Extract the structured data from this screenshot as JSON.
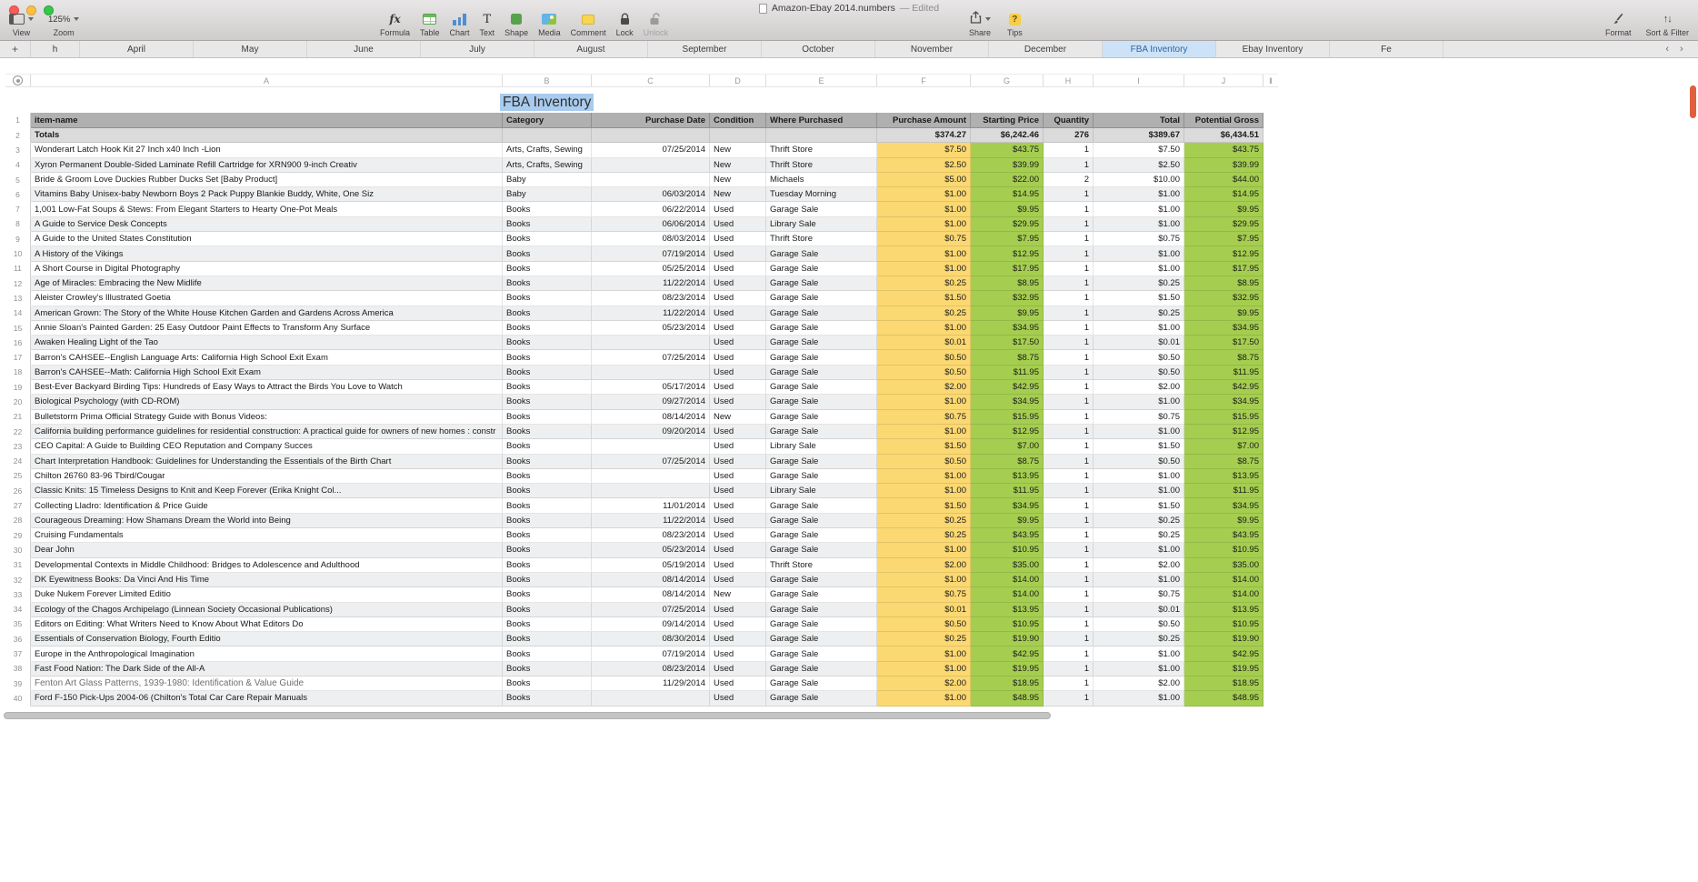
{
  "window": {
    "title": "Amazon-Ebay 2014.numbers",
    "edited": "— Edited"
  },
  "icons": {
    "formula": "fx",
    "text": "T",
    "tips": "?",
    "sort_filter": "↑↓",
    "add_tab": "+",
    "add_column": "‖",
    "tab_prev": "‹",
    "tab_next": "›"
  },
  "toolbar": {
    "view_label": "View",
    "zoom_label": "Zoom",
    "zoom_value": "125%",
    "center": [
      "Formula",
      "Table",
      "Chart",
      "Text",
      "Shape",
      "Media",
      "Comment",
      "Lock",
      "Unlock"
    ],
    "share_label": "Share",
    "tips_label": "Tips",
    "format_label": "Format",
    "sort_filter_label": "Sort & Filter"
  },
  "tabs": {
    "items": [
      "h",
      "April",
      "May",
      "June",
      "July",
      "August",
      "September",
      "October",
      "November",
      "December",
      "FBA Inventory",
      "Ebay Inventory",
      "Fe"
    ],
    "active": "FBA Inventory"
  },
  "sheet": {
    "column_letters": [
      "A",
      "B",
      "C",
      "D",
      "E",
      "F",
      "G",
      "H",
      "I",
      "J"
    ],
    "table_title": "FBA Inventory",
    "first_data_row_number": 3,
    "muted_row_numbers": [
      39
    ],
    "headers": [
      "item-name",
      "Category",
      "Purchase Date",
      "Condition",
      "Where Purchased",
      "Purchase Amount",
      "Starting Price",
      "Quantity",
      "Total",
      "Potential Gross"
    ],
    "totals": [
      "Totals",
      "",
      "",
      "",
      "",
      "$374.27",
      "$6,242.46",
      "276",
      "$389.67",
      "$6,434.51"
    ],
    "rows": [
      [
        "Wonderart Latch Hook Kit 27 Inch x40 Inch -Lion",
        "Arts, Crafts, Sewing",
        "07/25/2014",
        "New",
        "Thrift Store",
        "$7.50",
        "$43.75",
        "1",
        "$7.50",
        "$43.75"
      ],
      [
        "Xyron Permanent Double-Sided Laminate Refill Cartridge for XRN900 9-inch Creativ",
        "Arts, Crafts, Sewing",
        "",
        "New",
        "Thrift Store",
        "$2.50",
        "$39.99",
        "1",
        "$2.50",
        "$39.99"
      ],
      [
        "Bride & Groom Love Duckies Rubber Ducks Set [Baby Product]",
        "Baby",
        "",
        "New",
        "Michaels",
        "$5.00",
        "$22.00",
        "2",
        "$10.00",
        "$44.00"
      ],
      [
        "Vitamins Baby Unisex-baby Newborn Boys 2 Pack Puppy Blankie Buddy, White, One Siz",
        "Baby",
        "06/03/2014",
        "New",
        "Tuesday Morning",
        "$1.00",
        "$14.95",
        "1",
        "$1.00",
        "$14.95"
      ],
      [
        "1,001 Low-Fat Soups & Stews: From Elegant Starters to Hearty One-Pot Meals",
        "Books",
        "06/22/2014",
        "Used",
        "Garage Sale",
        "$1.00",
        "$9.95",
        "1",
        "$1.00",
        "$9.95"
      ],
      [
        "A Guide to Service Desk Concepts",
        "Books",
        "06/06/2014",
        "Used",
        "Library Sale",
        "$1.00",
        "$29.95",
        "1",
        "$1.00",
        "$29.95"
      ],
      [
        "A Guide to the United States Constitution",
        "Books",
        "08/03/2014",
        "Used",
        "Thrift Store",
        "$0.75",
        "$7.95",
        "1",
        "$0.75",
        "$7.95"
      ],
      [
        "A History of the Vikings",
        "Books",
        "07/19/2014",
        "Used",
        "Garage Sale",
        "$1.00",
        "$12.95",
        "1",
        "$1.00",
        "$12.95"
      ],
      [
        "A Short Course in Digital Photography",
        "Books",
        "05/25/2014",
        "Used",
        "Garage Sale",
        "$1.00",
        "$17.95",
        "1",
        "$1.00",
        "$17.95"
      ],
      [
        "Age of Miracles: Embracing the New Midlife",
        "Books",
        "11/22/2014",
        "Used",
        "Garage Sale",
        "$0.25",
        "$8.95",
        "1",
        "$0.25",
        "$8.95"
      ],
      [
        "Aleister Crowley's Illustrated Goetia",
        "Books",
        "08/23/2014",
        "Used",
        "Garage Sale",
        "$1.50",
        "$32.95",
        "1",
        "$1.50",
        "$32.95"
      ],
      [
        "American Grown: The Story of the White House Kitchen Garden and Gardens Across America",
        "Books",
        "11/22/2014",
        "Used",
        "Garage Sale",
        "$0.25",
        "$9.95",
        "1",
        "$0.25",
        "$9.95"
      ],
      [
        "Annie Sloan's Painted Garden: 25 Easy Outdoor Paint Effects to Transform Any Surface",
        "Books",
        "05/23/2014",
        "Used",
        "Garage Sale",
        "$1.00",
        "$34.95",
        "1",
        "$1.00",
        "$34.95"
      ],
      [
        "Awaken Healing Light of the Tao",
        "Books",
        "",
        "Used",
        "Garage Sale",
        "$0.01",
        "$17.50",
        "1",
        "$0.01",
        "$17.50"
      ],
      [
        "Barron's CAHSEE--English Language Arts: California High School Exit Exam",
        "Books",
        "07/25/2014",
        "Used",
        "Garage Sale",
        "$0.50",
        "$8.75",
        "1",
        "$0.50",
        "$8.75"
      ],
      [
        "Barron's CAHSEE--Math: California High School Exit Exam",
        "Books",
        "",
        "Used",
        "Garage Sale",
        "$0.50",
        "$11.95",
        "1",
        "$0.50",
        "$11.95"
      ],
      [
        "Best-Ever Backyard Birding Tips: Hundreds of Easy Ways to Attract the Birds You Love to Watch",
        "Books",
        "05/17/2014",
        "Used",
        "Garage Sale",
        "$2.00",
        "$42.95",
        "1",
        "$2.00",
        "$42.95"
      ],
      [
        "Biological Psychology (with CD-ROM)",
        "Books",
        "09/27/2014",
        "Used",
        "Garage Sale",
        "$1.00",
        "$34.95",
        "1",
        "$1.00",
        "$34.95"
      ],
      [
        "Bulletstorm Prima Official Strategy Guide with Bonus Videos:",
        "Books",
        "08/14/2014",
        "New",
        "Garage Sale",
        "$0.75",
        "$15.95",
        "1",
        "$0.75",
        "$15.95"
      ],
      [
        "California building performance guidelines for residential construction: A practical guide for owners of new homes : constr",
        "Books",
        "09/20/2014",
        "Used",
        "Garage Sale",
        "$1.00",
        "$12.95",
        "1",
        "$1.00",
        "$12.95"
      ],
      [
        "CEO Capital: A Guide to Building CEO Reputation and Company Succes",
        "Books",
        "",
        "Used",
        "Library Sale",
        "$1.50",
        "$7.00",
        "1",
        "$1.50",
        "$7.00"
      ],
      [
        "Chart Interpretation Handbook: Guidelines for Understanding the Essentials of the Birth Chart",
        "Books",
        "07/25/2014",
        "Used",
        "Garage Sale",
        "$0.50",
        "$8.75",
        "1",
        "$0.50",
        "$8.75"
      ],
      [
        "Chilton 26760 83-96 Tbird/Cougar",
        "Books",
        "",
        "Used",
        "Garage Sale",
        "$1.00",
        "$13.95",
        "1",
        "$1.00",
        "$13.95"
      ],
      [
        "Classic Knits: 15 Timeless Designs to Knit and Keep Forever (Erika Knight Col...",
        "Books",
        "",
        "Used",
        "Library Sale",
        "$1.00",
        "$11.95",
        "1",
        "$1.00",
        "$11.95"
      ],
      [
        "Collecting Lladro: Identification & Price Guide",
        "Books",
        "11/01/2014",
        "Used",
        "Garage Sale",
        "$1.50",
        "$34.95",
        "1",
        "$1.50",
        "$34.95"
      ],
      [
        "Courageous Dreaming: How Shamans Dream the World into Being",
        "Books",
        "11/22/2014",
        "Used",
        "Garage Sale",
        "$0.25",
        "$9.95",
        "1",
        "$0.25",
        "$9.95"
      ],
      [
        "Cruising Fundamentals",
        "Books",
        "08/23/2014",
        "Used",
        "Garage Sale",
        "$0.25",
        "$43.95",
        "1",
        "$0.25",
        "$43.95"
      ],
      [
        "Dear John",
        "Books",
        "05/23/2014",
        "Used",
        "Garage Sale",
        "$1.00",
        "$10.95",
        "1",
        "$1.00",
        "$10.95"
      ],
      [
        "Developmental Contexts in Middle Childhood: Bridges to Adolescence and Adulthood",
        "Books",
        "05/19/2014",
        "Used",
        "Thrift Store",
        "$2.00",
        "$35.00",
        "1",
        "$2.00",
        "$35.00"
      ],
      [
        "DK Eyewitness Books: Da Vinci And His Time",
        "Books",
        "08/14/2014",
        "Used",
        "Garage Sale",
        "$1.00",
        "$14.00",
        "1",
        "$1.00",
        "$14.00"
      ],
      [
        "Duke Nukem Forever Limited Editio",
        "Books",
        "08/14/2014",
        "New",
        "Garage Sale",
        "$0.75",
        "$14.00",
        "1",
        "$0.75",
        "$14.00"
      ],
      [
        "Ecology of the Chagos Archipelago (Linnean Society Occasional Publications)",
        "Books",
        "07/25/2014",
        "Used",
        "Garage Sale",
        "$0.01",
        "$13.95",
        "1",
        "$0.01",
        "$13.95"
      ],
      [
        "Editors on Editing: What Writers Need to Know About What Editors Do",
        "Books",
        "09/14/2014",
        "Used",
        "Garage Sale",
        "$0.50",
        "$10.95",
        "1",
        "$0.50",
        "$10.95"
      ],
      [
        "Essentials of Conservation Biology, Fourth Editio",
        "Books",
        "08/30/2014",
        "Used",
        "Garage Sale",
        "$0.25",
        "$19.90",
        "1",
        "$0.25",
        "$19.90"
      ],
      [
        "Europe in the Anthropological Imagination",
        "Books",
        "07/19/2014",
        "Used",
        "Garage Sale",
        "$1.00",
        "$42.95",
        "1",
        "$1.00",
        "$42.95"
      ],
      [
        "Fast Food Nation: The Dark Side of the All-A",
        "Books",
        "08/23/2014",
        "Used",
        "Garage Sale",
        "$1.00",
        "$19.95",
        "1",
        "$1.00",
        "$19.95"
      ],
      [
        "Fenton Art Glass Patterns, 1939-1980: Identification & Value Guide",
        "Books",
        "11/29/2014",
        "Used",
        "Garage Sale",
        "$2.00",
        "$18.95",
        "1",
        "$2.00",
        "$18.95"
      ],
      [
        "Ford F-150 Pick-Ups 2004-06 (Chilton's Total Car Care Repair Manuals",
        "Books",
        "",
        "Used",
        "Garage Sale",
        "$1.00",
        "$48.95",
        "1",
        "$1.00",
        "$48.95"
      ]
    ]
  },
  "colors": {
    "header_row_bg": "#b0b0b0",
    "totals_row_bg": "#dbdbdb",
    "row_alt_bg": "#edeff0",
    "purchase_amount_bg": "#fbd871",
    "price_green_bg": "#a5ce50",
    "tab_active_bg": "#cde2f6",
    "title_selection_bg": "#a8cbee",
    "scroll_accent": "#e0603d"
  }
}
